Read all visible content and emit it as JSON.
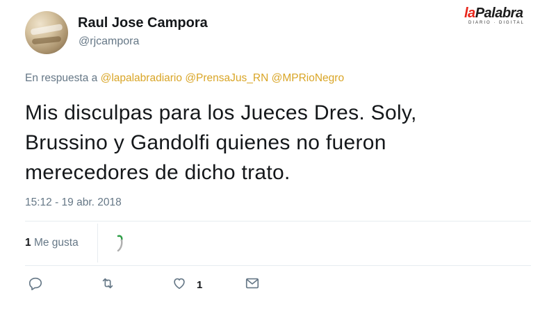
{
  "author": {
    "name": "Raul Jose Campora",
    "handle": "@rjcampora"
  },
  "logo": {
    "brand_la": "la",
    "brand_rest": "Palabra",
    "tagline": "DIARIO · DIGITAL"
  },
  "reply": {
    "prefix": "En respuesta a",
    "mentions": [
      "@lapalabradiario",
      "@PrensaJus_RN",
      "@MPRioNegro"
    ]
  },
  "tweet": {
    "lines": [
      "Mis disculpas para los Jueces Dres. Soly,",
      "Brussino y Gandolfi quienes no fueron",
      "merecedores de dicho trato."
    ],
    "timestamp": "15:12 - 19 abr. 2018"
  },
  "stats": {
    "likes_count": "1",
    "likes_label": "Me gusta"
  },
  "actions": {
    "like_count": "1"
  },
  "icons": {
    "reply": "reply-icon",
    "retweet": "retweet-icon",
    "like": "heart-icon",
    "dm": "envelope-icon"
  },
  "colors": {
    "mention": "#d9a526",
    "secondary_text": "#657786",
    "primary_text": "#14171a",
    "brand_red": "#e8261b"
  }
}
